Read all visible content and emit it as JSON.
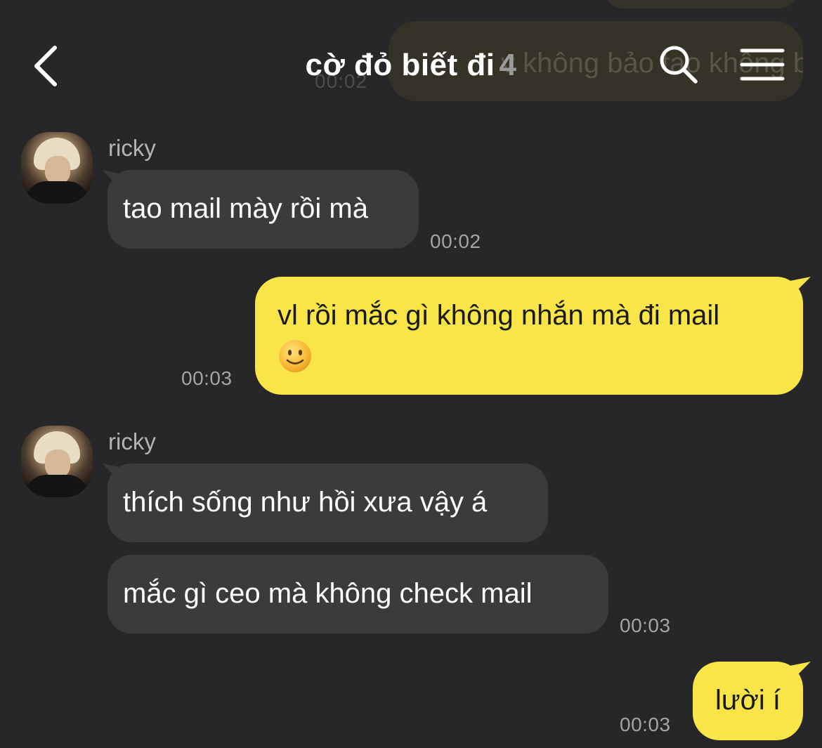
{
  "header": {
    "title": "cờ đỏ biết đi",
    "member_count": "4"
  },
  "background_ghost": {
    "text": "v không bảo tao không báo tao",
    "time": "00:02"
  },
  "messages": [
    {
      "sender": "ricky",
      "text": "tao mail mày rồi mà",
      "time": "00:02"
    },
    {
      "text_line1": "vl rồi mắc gì không nhắn mà đi mail",
      "emoji": "slightly-smiling-face",
      "time": "00:03"
    },
    {
      "sender": "ricky",
      "text": "thích sống như hồi xưa vậy á"
    },
    {
      "text": "mắc gì ceo mà không check mail",
      "time": "00:03"
    },
    {
      "text": "lười í",
      "time": "00:03"
    }
  ],
  "colors": {
    "background": "#272729",
    "incoming_bubble": "#3b3b3e",
    "outgoing_bubble": "#f9e547",
    "timestamp": "#a4a4a6"
  }
}
